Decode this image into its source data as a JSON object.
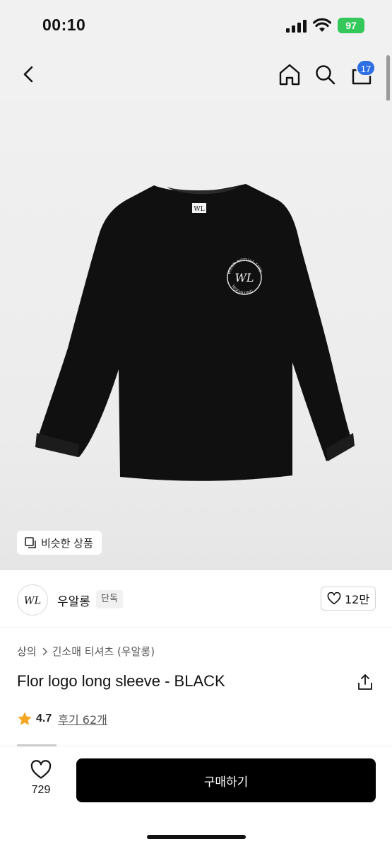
{
  "status_bar": {
    "time": "00:10",
    "battery": "97"
  },
  "nav": {
    "cart_count": "17"
  },
  "product_image": {
    "similar_label": "비슷한 상품",
    "shirt_text_top": "WEAR ACTUAL LIFE",
    "shirt_text_bottom": "WOOALONG"
  },
  "brand": {
    "name": "우알롱",
    "tag": "단독",
    "likes": "12만"
  },
  "breadcrumb": {
    "category": "상의",
    "subcategory": "긴소매 티셔츠 (우알롱)"
  },
  "product": {
    "title": "Flor logo long sleeve - BLACK",
    "rating": "4.7",
    "reviews": "후기 62개"
  },
  "bottom": {
    "wish_count": "729",
    "buy_label": "구매하기"
  },
  "colors": {
    "badge": "#2f6fe4",
    "battery": "#34c759",
    "star": "#f5a623",
    "buy_button": "#000000"
  }
}
